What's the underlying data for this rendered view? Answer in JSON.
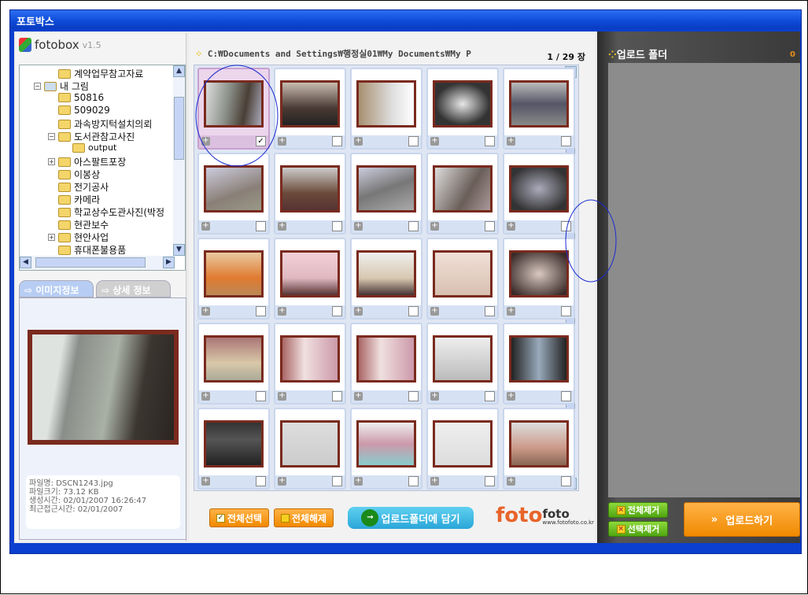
{
  "window": {
    "title": "포토박스"
  },
  "logo": {
    "name": "fotobox",
    "version": "v1.5"
  },
  "tree": {
    "items": [
      {
        "label": "계약업무참고자료",
        "level": 2,
        "toggle": ""
      },
      {
        "label": "내 그림",
        "level": 1,
        "toggle": "−",
        "special": true
      },
      {
        "label": "50816",
        "level": 2,
        "toggle": ""
      },
      {
        "label": "509029",
        "level": 2,
        "toggle": ""
      },
      {
        "label": "과속방지턱설치의뢰",
        "level": 2,
        "toggle": ""
      },
      {
        "label": "도서관참고사진",
        "level": 2,
        "toggle": "−"
      },
      {
        "label": "output",
        "level": 3,
        "toggle": ""
      },
      {
        "label": "아스팔트포장",
        "level": 2,
        "toggle": "+"
      },
      {
        "label": "이봉상",
        "level": 2,
        "toggle": ""
      },
      {
        "label": "전기공사",
        "level": 2,
        "toggle": ""
      },
      {
        "label": "카메라",
        "level": 2,
        "toggle": ""
      },
      {
        "label": "학교상수도관사진(박정",
        "level": 2,
        "toggle": ""
      },
      {
        "label": "현관보수",
        "level": 2,
        "toggle": ""
      },
      {
        "label": "현안사업",
        "level": 2,
        "toggle": "+"
      },
      {
        "label": "휴대폰불용품",
        "level": 2,
        "toggle": ""
      }
    ]
  },
  "tabs": {
    "image_info": "이미지정보",
    "detail_info": "상세 정보"
  },
  "info": {
    "filename": "파일명: DSCN1243.jpg",
    "filesize": "파일크기: 73.12 KB",
    "created": "생성시간: 02/01/2007 16:26:47",
    "accessed": "최근접근시간: 02/01/2007"
  },
  "browser": {
    "path": "C:₩Documents and Settings₩행정실01₩My Documents₩My P",
    "count": "1 / 29 장"
  },
  "thumbs": [
    {
      "c": "linear-gradient(100deg,#ddd,#8a8f88 40%,#4a3f36 70%,#aab)",
      "checked": true,
      "selected": true
    },
    {
      "c": "linear-gradient(#c8bcb0,#4a3a34 60%,#222)",
      "checked": false
    },
    {
      "c": "linear-gradient(90deg,#a89070,#ddd 60%,#fff)",
      "checked": false
    },
    {
      "c": "radial-gradient(#e8e8e8,#333 70%)",
      "checked": false
    },
    {
      "c": "linear-gradient(#bbb,#556 50%,#888)",
      "checked": false
    },
    {
      "c": "linear-gradient(160deg,#ccd,#8a7f77 60%,#998)",
      "checked": false
    },
    {
      "c": "linear-gradient(#ccc,#6b4a3a 60%,#533)",
      "checked": false
    },
    {
      "c": "linear-gradient(160deg,#ccd,#777 50%,#aaa)",
      "checked": false
    },
    {
      "c": "linear-gradient(120deg,#ddd,#6a5e58 60%,#a99)",
      "checked": false
    },
    {
      "c": "radial-gradient(#aab,#333 80%)",
      "checked": false
    },
    {
      "c": "linear-gradient(#e9c9a0,#e07a30 60%,#b85)",
      "checked": false
    },
    {
      "c": "linear-gradient(#f2d0d8,#e0b8c0 60%,#533)",
      "checked": false
    },
    {
      "c": "linear-gradient(#eee,#d8c8b0 60%,#433)",
      "checked": false
    },
    {
      "c": "linear-gradient(#f0e0d8,#d8c0b0)",
      "checked": false
    },
    {
      "c": "radial-gradient(#d8c8c0,#3a2a28 90%)",
      "checked": false
    },
    {
      "c": "linear-gradient(#a77,#d8c8a8 60%,#aa9)",
      "checked": false
    },
    {
      "c": "linear-gradient(90deg,#a66,#f0e0e0 40%,#c9a)",
      "checked": false
    },
    {
      "c": "linear-gradient(90deg,#a66,#f0e0e0 40%,#c9a)",
      "checked": false
    },
    {
      "c": "linear-gradient(#eee,#bbb)",
      "checked": false
    },
    {
      "c": "linear-gradient(90deg,#222,#9ab 50%,#222)",
      "checked": false
    },
    {
      "c": "linear-gradient(#333,#555 40%,#222)",
      "checked": false
    },
    {
      "c": "linear-gradient(#ddd,#ccc)",
      "checked": false
    },
    {
      "c": "linear-gradient(#eee,#c9a 50%,#8cc)",
      "checked": false
    },
    {
      "c": "linear-gradient(#eee,#ddd)",
      "checked": false
    },
    {
      "c": "linear-gradient(#ddd,#c98 60%,#865)",
      "checked": false
    }
  ],
  "buttons": {
    "select_all": "전체선택",
    "deselect_all": "전체해제",
    "add_to_upload": "업로드폴더에 담기",
    "remove_all": "전체제거",
    "remove_selected": "선택제거",
    "upload": "업로드하기"
  },
  "brand": {
    "text": "foto",
    "sub": "foto",
    "url": "www.fotofoto.co.kr"
  },
  "upload_panel": {
    "title": "업로드 폴더",
    "count": "0"
  }
}
